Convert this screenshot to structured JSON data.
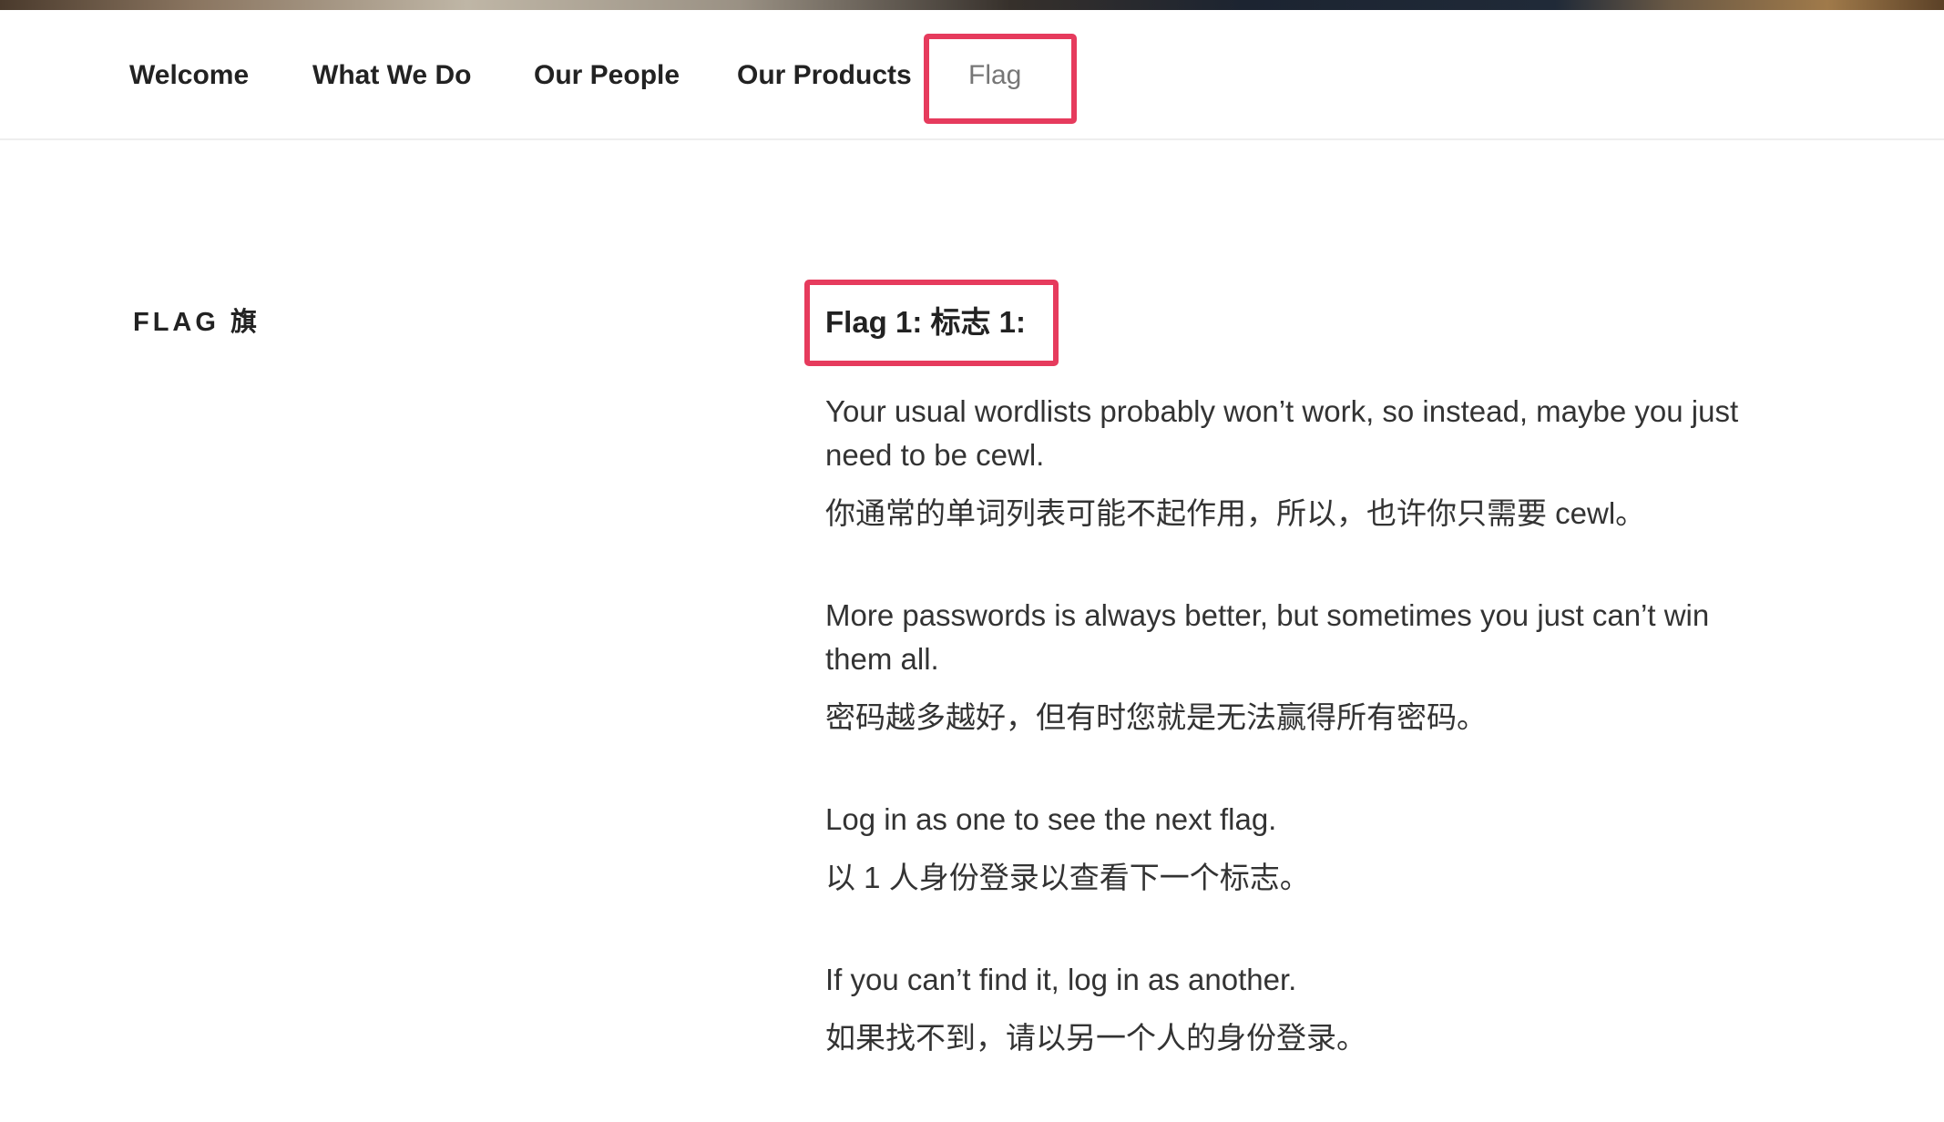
{
  "nav": {
    "items": [
      {
        "label": "Welcome"
      },
      {
        "label": "What We Do"
      },
      {
        "label": "Our People"
      },
      {
        "label": "Our Products"
      },
      {
        "label": "Flag"
      }
    ],
    "current": "Flag"
  },
  "page": {
    "title": "FLAG 旗"
  },
  "content": {
    "heading": "Flag 1: 标志 1:",
    "paragraphs": [
      "Your usual wordlists probably won’t work, so instead, maybe you just need to be cewl.",
      "你通常的单词列表可能不起作用，所以，也许你只需要 cewl。",
      "More passwords is always better, but sometimes you just can’t win them all.",
      "密码越多越好，但有时您就是无法赢得所有密码。",
      "Log in as one to see the next flag.",
      "以 1 人身份登录以查看下一个标志。",
      "If you can’t find it, log in as another.",
      "如果找不到，请以另一个人的身份登录。"
    ]
  },
  "colors": {
    "highlight": "#e63b5d",
    "text": "#222222",
    "current_nav": "#767676"
  }
}
